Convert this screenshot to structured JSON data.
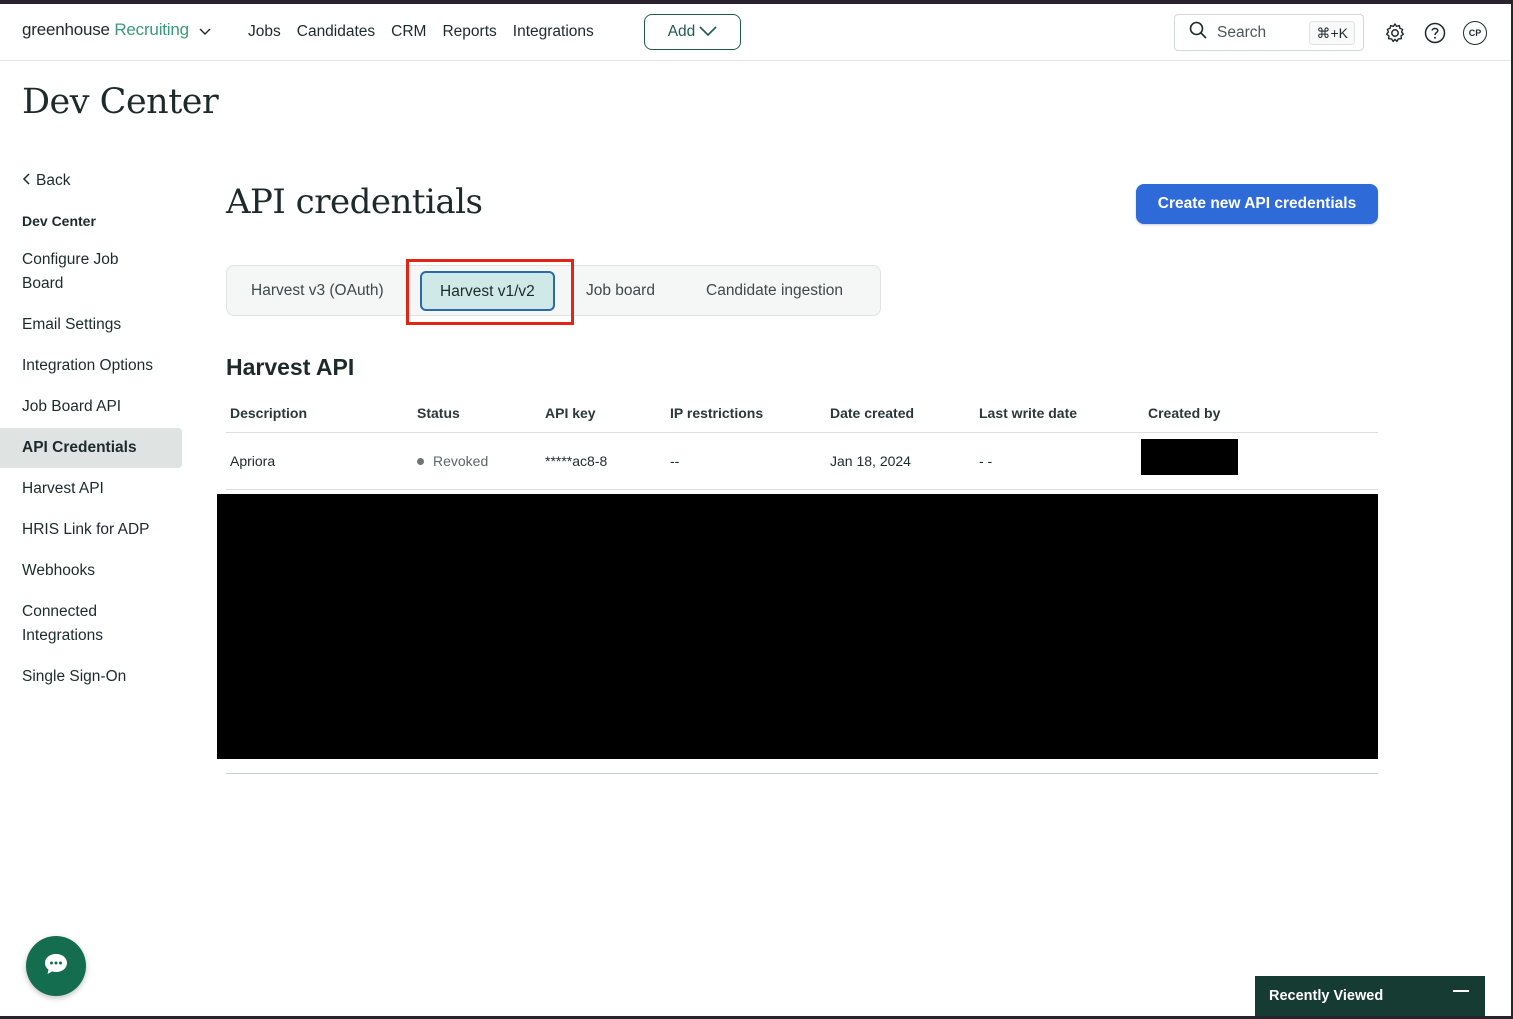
{
  "app": {
    "logo_brand": "greenhouse",
    "logo_product": "Recruiting"
  },
  "nav": {
    "links": [
      "Jobs",
      "Candidates",
      "CRM",
      "Reports",
      "Integrations"
    ],
    "add_label": "Add",
    "search_label": "Search",
    "search_shortcut": "⌘+K",
    "avatar_initials": "CP"
  },
  "page": {
    "title": "Dev Center"
  },
  "sidebar": {
    "back_label": "Back",
    "heading": "Dev Center",
    "items": [
      {
        "label": "Configure Job Board",
        "active": false
      },
      {
        "label": "Email Settings",
        "active": false
      },
      {
        "label": "Integration Options",
        "active": false
      },
      {
        "label": "Job Board API",
        "active": false
      },
      {
        "label": "API Credentials",
        "active": true
      },
      {
        "label": "Harvest API",
        "active": false
      },
      {
        "label": "HRIS Link for ADP",
        "active": false
      },
      {
        "label": "Webhooks",
        "active": false
      },
      {
        "label": "Connected Integrations",
        "active": false
      },
      {
        "label": "Single Sign-On",
        "active": false
      }
    ]
  },
  "main": {
    "title": "API credentials",
    "create_button": "Create new API credentials",
    "tabs": [
      {
        "label": "Harvest v3 (OAuth)",
        "selected": false
      },
      {
        "label": "Harvest v1/v2",
        "selected": true
      },
      {
        "label": "Job board",
        "selected": false
      },
      {
        "label": "Candidate ingestion",
        "selected": false
      }
    ],
    "section_title": "Harvest API",
    "table": {
      "headers": [
        "Description",
        "Status",
        "API key",
        "IP restrictions",
        "Date created",
        "Last write date",
        "Created by"
      ],
      "rows": [
        {
          "description": "Apriora",
          "status": "Revoked",
          "api_key": "*****ac8-8",
          "ip_restrictions": "--",
          "date_created": "Jan 18, 2024",
          "last_write_date": "- -",
          "created_by": ""
        }
      ]
    }
  },
  "footer": {
    "recently_viewed": "Recently Viewed"
  },
  "colors": {
    "primary_button": "#2f6bd8",
    "brand_green": "#146d4f",
    "selected_tab_bg": "#cfe9e8",
    "highlight_outline": "#e02614"
  }
}
